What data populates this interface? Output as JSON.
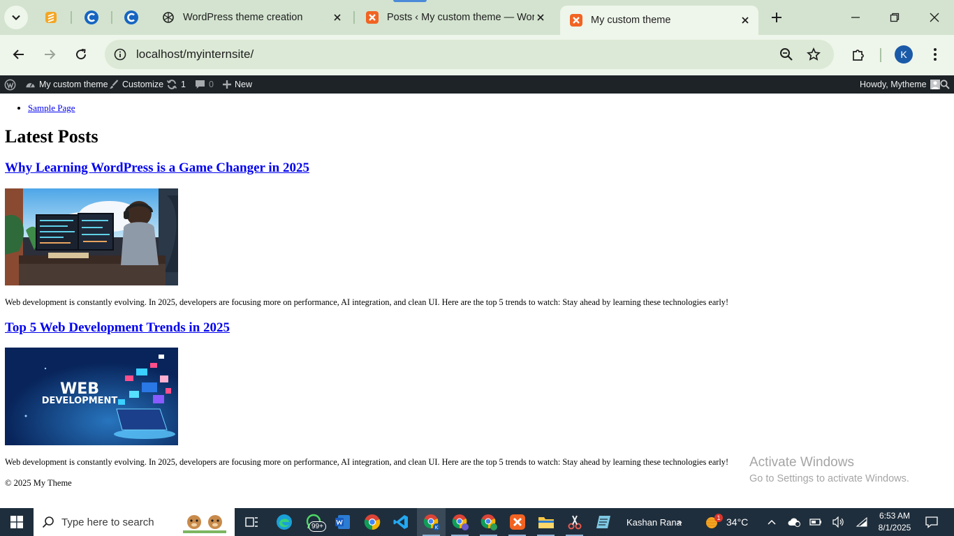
{
  "browser": {
    "tabs": [
      {
        "title": "WordPress theme creation",
        "favicon": "chatgpt-icon",
        "active": false
      },
      {
        "title": "Posts ‹ My custom theme — WordPress",
        "favicon": "xampp-icon",
        "active": false
      },
      {
        "title": "My custom theme",
        "favicon": "xampp-icon",
        "active": true
      }
    ],
    "url": "localhost/myinternsite/",
    "profile_initial": "K"
  },
  "admin_bar": {
    "site_name": "My custom theme",
    "customize": "Customize",
    "updates_count": "1",
    "comments_count": "0",
    "new_label": "New",
    "howdy": "Howdy, Mytheme"
  },
  "site": {
    "menu": [
      "Sample Page"
    ],
    "section_title": "Latest Posts",
    "posts": [
      {
        "title": "Why Learning WordPress is a Game Changer in 2025",
        "excerpt": "Web development is constantly evolving. In 2025, developers are focusing more on performance, AI integration, and clean UI. Here are the top 5 trends to watch: Stay ahead by learning these technologies early!"
      },
      {
        "title": "Top 5 Web Development Trends in 2025",
        "image_text_line1": "WEB",
        "image_text_line2": "DEVELOPMENT",
        "excerpt": "Web development is constantly evolving. In 2025, developers are focusing more on performance, AI integration, and clean UI. Here are the top 5 trends to watch: Stay ahead by learning these technologies early!"
      }
    ],
    "footer": "© 2025 My Theme"
  },
  "watermark": {
    "title": "Activate Windows",
    "subtitle": "Go to Settings to activate Windows."
  },
  "taskbar": {
    "search_placeholder": "Type here to search",
    "whatsapp_badge": "99+",
    "user_label": "Kashan Rana",
    "weather_badge": "1",
    "temperature": "34°C",
    "time": "6:53 AM",
    "date": "8/1/2025"
  },
  "colors": {
    "tabstrip": "#d3e3cf",
    "toolbar": "#eef5ea",
    "admin_bar": "#1d2327",
    "link": "#0000ee",
    "taskbar": "#1f2e3c"
  }
}
